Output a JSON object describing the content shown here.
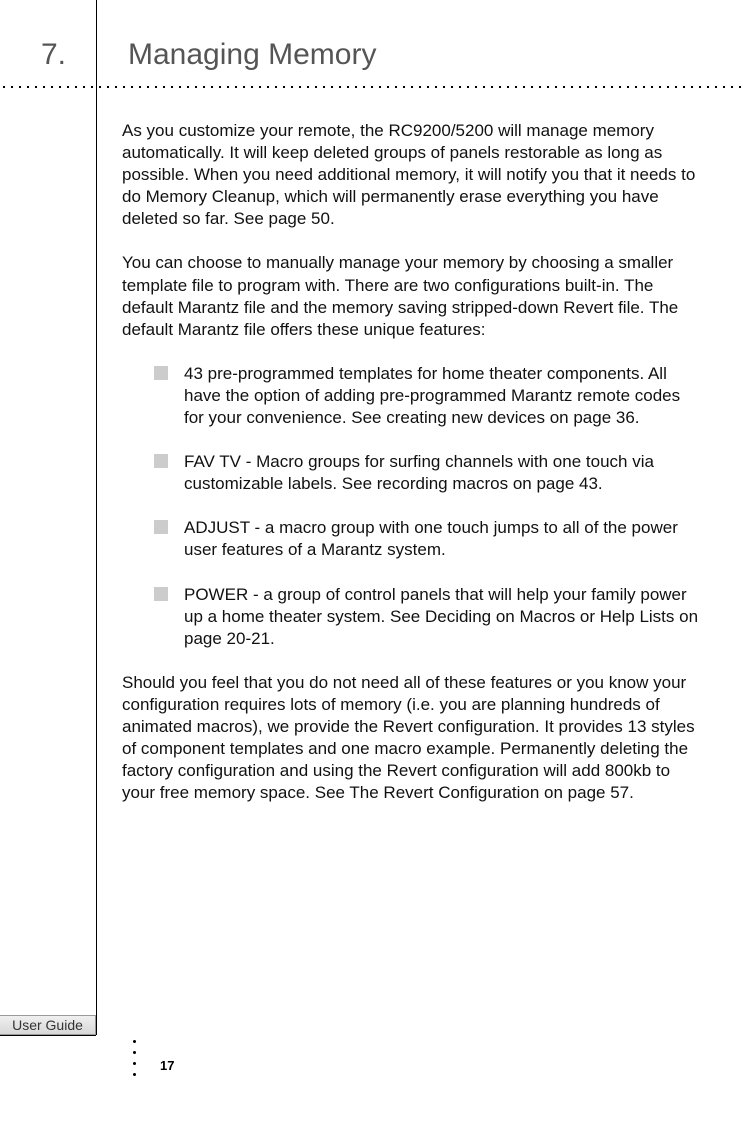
{
  "chapter": {
    "number": "7.",
    "title": "Managing Memory"
  },
  "paragraphs": {
    "p1": "As you customize your remote, the RC9200/5200 will manage memory automatically. It will keep deleted groups of panels restorable as long as possible. When you need additional memory, it will notify you that it needs to do  Memory Cleanup,  which will permanently erase everything you have deleted so far. See page 50.",
    "p2": "You can choose to manually manage your memory by choosing a smaller template file to program with. There are two configurations built-in.  The default Marantz file and the memory saving stripped-down Revert file. The default Marantz file offers these unique features:",
    "p3": "Should you feel that you do not need all of these features or you know your configuration requires lots of memory (i.e. you are planning hundreds of animated macros), we provide the Revert configuration. It provides 13 styles of component templates and one macro example. Permanently deleting the factory configuration and using the Revert configuration will add 800kb to your free memory space. See The Revert Configuration on page 57."
  },
  "bullets": {
    "b1": "43 pre-programmed templates for home theater components. All have the option of adding pre-programmed Marantz remote codes for your convenience. See creating new devices on page 36.",
    "b2": "FAV TV - Macro groups for surfing channels with one touch via customizable labels. See recording macros on page 43.",
    "b3": "ADJUST - a macro group with one touch jumps to all of the power user features of a Marantz system.",
    "b4": "POWER - a group of control panels that will help your family power up a home theater system. See Deciding on Macros or Help Lists on page 20-21."
  },
  "footer": {
    "user_guide": "User Guide",
    "page_number": "17"
  }
}
